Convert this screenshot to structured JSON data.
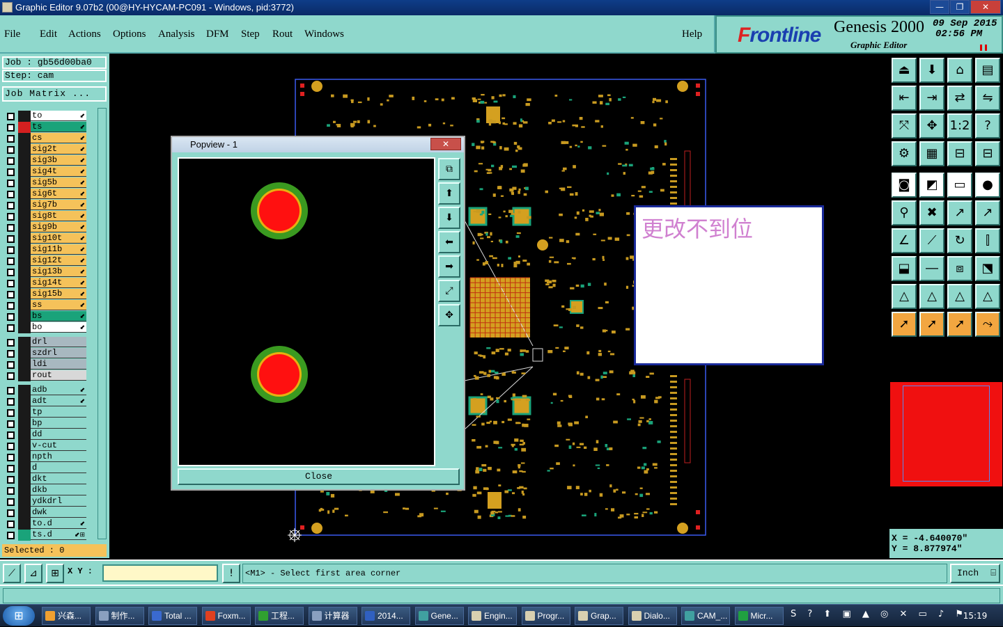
{
  "window": {
    "title": "Graphic Editor 9.07b2 (00@HY-HYCAM-PC091 - Windows, pid:3772)",
    "minimize": "—",
    "restore": "❐",
    "close": "✕"
  },
  "menu": {
    "items": [
      "File",
      "Edit",
      "Actions",
      "Options",
      "Analysis",
      "DFM",
      "Step",
      "Rout",
      "Windows"
    ],
    "help": "Help"
  },
  "brand": {
    "logo_f": "F",
    "logo_rest": "rontline",
    "product": "Genesis 2000",
    "subtitle": "Graphic Editor",
    "date_line1": "09 Sep 2015",
    "date_line2": "02:56 PM"
  },
  "job": {
    "job_text": "Job  : gb56d00ba0",
    "step_text": "Step: cam",
    "matrix_button": "Job Matrix ..."
  },
  "layers": [
    {
      "name": "to",
      "color": "#ffffff",
      "side": "#1a1a1a",
      "mark": "⬋"
    },
    {
      "name": "ts",
      "color": "#1aa37a",
      "side": "#d42020",
      "mark": "⬋"
    },
    {
      "name": "cs",
      "color": "#f5c25a",
      "side": "#1a1a1a",
      "mark": "⬋"
    },
    {
      "name": "sig2t",
      "color": "#f5c25a",
      "side": "#1a1a1a",
      "mark": "⬋"
    },
    {
      "name": "sig3b",
      "color": "#f5c25a",
      "side": "#1a1a1a",
      "mark": "⬋"
    },
    {
      "name": "sig4t",
      "color": "#f5c25a",
      "side": "#1a1a1a",
      "mark": "⬋"
    },
    {
      "name": "sig5b",
      "color": "#f5c25a",
      "side": "#1a1a1a",
      "mark": "⬋"
    },
    {
      "name": "sig6t",
      "color": "#f5c25a",
      "side": "#1a1a1a",
      "mark": "⬋"
    },
    {
      "name": "sig7b",
      "color": "#f5c25a",
      "side": "#1a1a1a",
      "mark": "⬋"
    },
    {
      "name": "sig8t",
      "color": "#f5c25a",
      "side": "#1a1a1a",
      "mark": "⬋"
    },
    {
      "name": "sig9b",
      "color": "#f5c25a",
      "side": "#1a1a1a",
      "mark": "⬋"
    },
    {
      "name": "sig10t",
      "color": "#f5c25a",
      "side": "#1a1a1a",
      "mark": "⬋"
    },
    {
      "name": "sig11b",
      "color": "#f5c25a",
      "side": "#1a1a1a",
      "mark": "⬋"
    },
    {
      "name": "sig12t",
      "color": "#f5c25a",
      "side": "#1a1a1a",
      "mark": "⬋"
    },
    {
      "name": "sig13b",
      "color": "#f5c25a",
      "side": "#1a1a1a",
      "mark": "⬋"
    },
    {
      "name": "sig14t",
      "color": "#f5c25a",
      "side": "#1a1a1a",
      "mark": "⬋"
    },
    {
      "name": "sig15b",
      "color": "#f5c25a",
      "side": "#1a1a1a",
      "mark": "⬋"
    },
    {
      "name": "ss",
      "color": "#f5c25a",
      "side": "#1a1a1a",
      "mark": "⬋"
    },
    {
      "name": "bs",
      "color": "#1aa37a",
      "side": "#1a1a1a",
      "mark": "⬋"
    },
    {
      "name": "bo",
      "color": "#ffffff",
      "side": "#1a1a1a",
      "mark": "⬋"
    },
    {
      "name": "drl",
      "color": "#a8b8c0",
      "side": "#1a1a1a",
      "mark": ""
    },
    {
      "name": "szdrl",
      "color": "#a8b8c0",
      "side": "#1a1a1a",
      "mark": ""
    },
    {
      "name": "ldi",
      "color": "#a8b8c0",
      "side": "#1a1a1a",
      "mark": ""
    },
    {
      "name": "rout",
      "color": "#d8d8d8",
      "side": "#1a1a1a",
      "mark": ""
    },
    {
      "name": "adb",
      "color": "#8fd8cc",
      "side": "#1a1a1a",
      "mark": "⬋"
    },
    {
      "name": "adt",
      "color": "#8fd8cc",
      "side": "#1a1a1a",
      "mark": "⬋"
    },
    {
      "name": "tp",
      "color": "#8fd8cc",
      "side": "#1a1a1a",
      "mark": ""
    },
    {
      "name": "bp",
      "color": "#8fd8cc",
      "side": "#1a1a1a",
      "mark": ""
    },
    {
      "name": "dd",
      "color": "#8fd8cc",
      "side": "#1a1a1a",
      "mark": ""
    },
    {
      "name": "v-cut",
      "color": "#8fd8cc",
      "side": "#1a1a1a",
      "mark": ""
    },
    {
      "name": "npth",
      "color": "#8fd8cc",
      "side": "#1a1a1a",
      "mark": ""
    },
    {
      "name": "d",
      "color": "#8fd8cc",
      "side": "#1a1a1a",
      "mark": ""
    },
    {
      "name": "dkt",
      "color": "#8fd8cc",
      "side": "#1a1a1a",
      "mark": ""
    },
    {
      "name": "dkb",
      "color": "#8fd8cc",
      "side": "#1a1a1a",
      "mark": ""
    },
    {
      "name": "ydkdrl",
      "color": "#8fd8cc",
      "side": "#1a1a1a",
      "mark": ""
    },
    {
      "name": "dwk",
      "color": "#8fd8cc",
      "side": "#1a1a1a",
      "mark": ""
    },
    {
      "name": "to.d",
      "color": "#8fd8cc",
      "side": "#1a1a1a",
      "mark": "⬋"
    },
    {
      "name": "ts.d",
      "color": "#8fd8cc",
      "side": "#1aa37a",
      "mark": "⬋⊞"
    }
  ],
  "selected_text": "Selected : 0",
  "popview": {
    "title": "Popview - 1",
    "close_label": "Close",
    "close_x": "✕"
  },
  "annotation": {
    "text": "更改不到位"
  },
  "coords": {
    "x_text": "X = -4.640070\"",
    "y_text": "Y = 8.877974\""
  },
  "bottom": {
    "xy_label": "X Y :",
    "xy_value": "",
    "prompt": "<M1> - Select first area corner",
    "unit": "Inch",
    "warn": "!"
  },
  "taskbar": {
    "start": "⊞",
    "items": [
      {
        "label": "兴森...",
        "color": "#f0a030"
      },
      {
        "label": "制作...",
        "color": "#8aa0c0"
      },
      {
        "label": "Total ...",
        "color": "#3a6ad0"
      },
      {
        "label": "Foxm...",
        "color": "#e04020"
      },
      {
        "label": "工程...",
        "color": "#30a030"
      },
      {
        "label": "计算器",
        "color": "#8aa0c0"
      },
      {
        "label": "2014...",
        "color": "#3060c0"
      },
      {
        "label": "Gene...",
        "color": "#40a0a0"
      },
      {
        "label": "Engin...",
        "color": "#d8d0b0"
      },
      {
        "label": "Progr...",
        "color": "#d8d0b0"
      },
      {
        "label": "Grap...",
        "color": "#d8d0b0"
      },
      {
        "label": "Dialo...",
        "color": "#d8d0b0"
      },
      {
        "label": "CAM_...",
        "color": "#40a0a0"
      },
      {
        "label": "Micr...",
        "color": "#20a040"
      }
    ],
    "clock": "15:19"
  }
}
